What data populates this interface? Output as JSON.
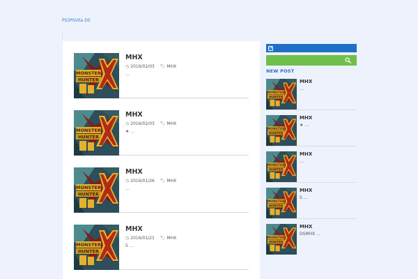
{
  "site": {
    "title": "PS3PSVita DS"
  },
  "articles": [
    {
      "title": "MHX",
      "date": "2016/02/03",
      "tag": "MHX",
      "excerpt": "…"
    },
    {
      "title": "MHX",
      "date": "2016/02/03",
      "tag": "MHX",
      "excerpt": "★ …"
    },
    {
      "title": "MHX",
      "date": "2016/01/26",
      "tag": "MHX",
      "excerpt": "…"
    },
    {
      "title": "MHX",
      "date": "2016/01/21",
      "tag": "MHX",
      "excerpt": "S …"
    }
  ],
  "sidebar": {
    "rss_icon": "rss-icon",
    "search_icon": "search-icon",
    "new_post_heading": "NEW POST",
    "new_posts": [
      {
        "title": "MHX",
        "excerpt": "…"
      },
      {
        "title": "MHX",
        "excerpt": "★ …"
      },
      {
        "title": "MHX",
        "excerpt": "…"
      },
      {
        "title": "MHX",
        "excerpt": "S …"
      },
      {
        "title": "MHX",
        "excerpt": "DSMHX …"
      }
    ]
  },
  "colors": {
    "background": "#eef2fc",
    "accent_blue": "#1f6fc6",
    "search_green": "#6fc04a",
    "link_blue": "#3a7fc4"
  }
}
